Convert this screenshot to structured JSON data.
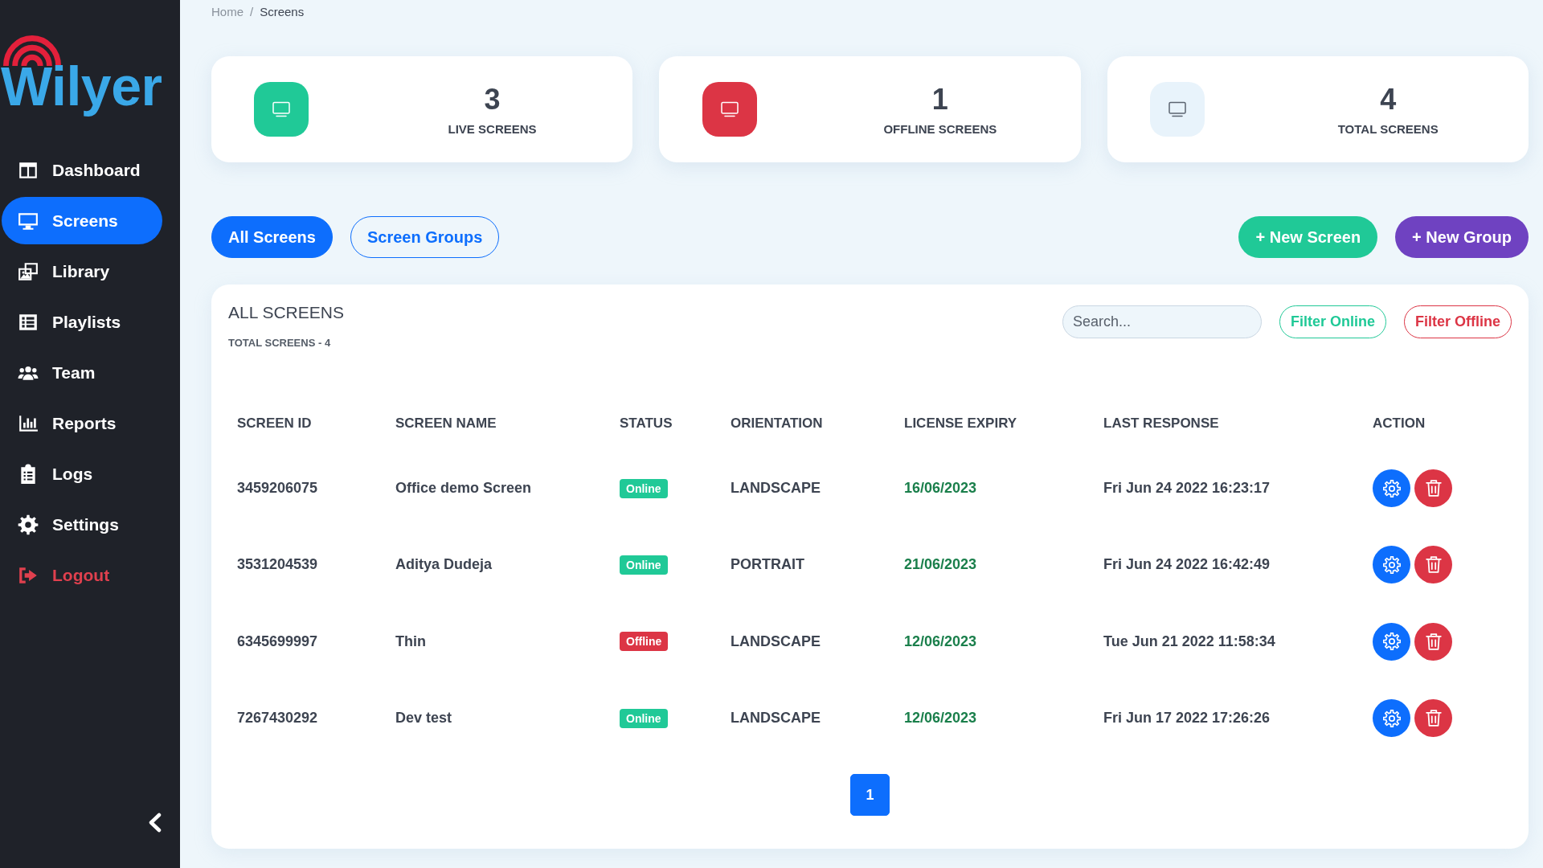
{
  "sidebar": {
    "logo": "Wilyer",
    "items": [
      {
        "label": "Dashboard",
        "selected": false,
        "kind": "nav"
      },
      {
        "label": "Screens",
        "selected": true,
        "kind": "nav"
      },
      {
        "label": "Library",
        "selected": false,
        "kind": "nav"
      },
      {
        "label": "Playlists",
        "selected": false,
        "kind": "nav"
      },
      {
        "label": "Team",
        "selected": false,
        "kind": "nav"
      },
      {
        "label": "Reports",
        "selected": false,
        "kind": "nav"
      },
      {
        "label": "Logs",
        "selected": false,
        "kind": "nav"
      },
      {
        "label": "Settings",
        "selected": false,
        "kind": "nav"
      },
      {
        "label": "Logout",
        "selected": false,
        "kind": "logout"
      }
    ]
  },
  "breadcrumb": {
    "items": [
      "Home",
      "Screens"
    ],
    "separator": "/"
  },
  "stats": [
    {
      "value": "3",
      "label": "LIVE SCREENS",
      "kind": "live"
    },
    {
      "value": "1",
      "label": "OFFLINE SCREENS",
      "kind": "offline"
    },
    {
      "value": "4",
      "label": "TOTAL SCREENS",
      "kind": "total"
    }
  ],
  "tabs": [
    {
      "label": "All Screens",
      "selected": true
    },
    {
      "label": "Screen Groups",
      "selected": false
    }
  ],
  "actions": [
    {
      "label": "+ New Screen",
      "color": "#20c997"
    },
    {
      "label": "+ New Group",
      "color": "#6f42c1"
    }
  ],
  "table": {
    "title": "ALL SCREENS",
    "subtitle": "TOTAL SCREENS - 4",
    "search": {
      "placeholder": "Search..."
    },
    "filters": [
      {
        "label": "Filter Online",
        "color": "#20c997"
      },
      {
        "label": "Filter Offline",
        "color": "#dc3545"
      }
    ],
    "columns": [
      "SCREEN ID",
      "SCREEN NAME",
      "STATUS",
      "ORIENTATION",
      "LICENSE EXPIRY",
      "LAST RESPONSE",
      "ACTION"
    ],
    "rows": [
      {
        "screen_id": "3459206075",
        "screen_name": "Office demo Screen",
        "status": {
          "label": "Online",
          "color": "#20c997"
        },
        "orientation": "LANDSCAPE",
        "license_expiry": "16/06/2023",
        "last_response": "Fri Jun 24 2022 16:23:17"
      },
      {
        "screen_id": "3531204539",
        "screen_name": "Aditya Dudeja",
        "status": {
          "label": "Online",
          "color": "#20c997"
        },
        "orientation": "PORTRAIT",
        "license_expiry": "21/06/2023",
        "last_response": "Fri Jun 24 2022 16:42:49"
      },
      {
        "screen_id": "6345699997",
        "screen_name": "Thin",
        "status": {
          "label": "Offline",
          "color": "#dc3545"
        },
        "orientation": "LANDSCAPE",
        "license_expiry": "12/06/2023",
        "last_response": "Tue Jun 21 2022 11:58:34"
      },
      {
        "screen_id": "7267430292",
        "screen_name": "Dev test",
        "status": {
          "label": "Online",
          "color": "#20c997"
        },
        "orientation": "LANDSCAPE",
        "license_expiry": "12/06/2023",
        "last_response": "Fri Jun 17 2022 17:26:26"
      }
    ]
  },
  "pagination": [
    {
      "label": "1",
      "selected": true
    }
  ]
}
